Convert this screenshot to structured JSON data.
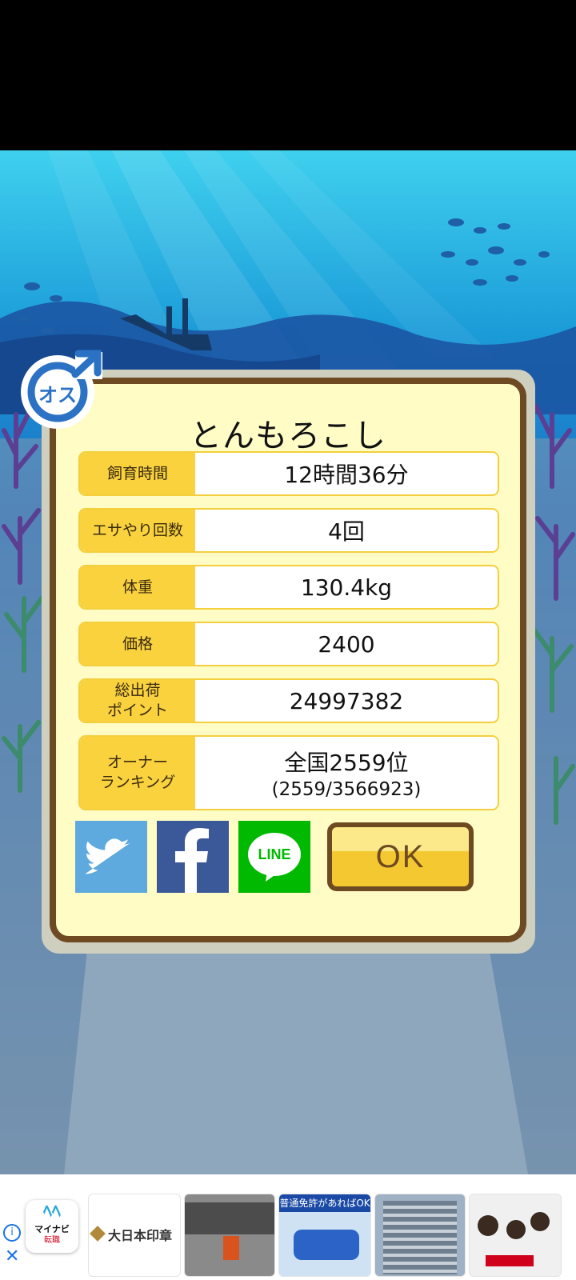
{
  "pet": {
    "name": "とんもろこし",
    "gender_badge": "オス",
    "gender_icon": "male-symbol"
  },
  "stats": [
    {
      "label": "飼育時間",
      "value": "12時間36分"
    },
    {
      "label": "エサやり回数",
      "value": "4回"
    },
    {
      "label": "体重",
      "value": "130.4kg"
    },
    {
      "label": "価格",
      "value": "2400"
    },
    {
      "label_line1": "総出荷",
      "label_line2": "ポイント",
      "value": "24997382"
    },
    {
      "label_line1": "オーナー",
      "label_line2": "ランキング",
      "value": "全国2559位",
      "sub_value": "(2559/3566923)"
    }
  ],
  "share": {
    "twitter_icon": "twitter-bird",
    "facebook_icon": "facebook-f",
    "line_label": "LINE"
  },
  "ok_button": {
    "label": "OK"
  },
  "ad": {
    "brand_name": "マイナビ",
    "brand_sub": "転職",
    "company": "大日本印章",
    "caption": "普通免許があればOK",
    "info_icon": "info-icon",
    "close_icon": "close-icon"
  },
  "colors": {
    "label_yellow": "#f9d23e",
    "frame_brown": "#6e4a23",
    "card_cream": "#fffcc6",
    "twitter_blue": "#5ea9dd",
    "facebook_blue": "#3b5998",
    "line_green": "#00b900"
  }
}
